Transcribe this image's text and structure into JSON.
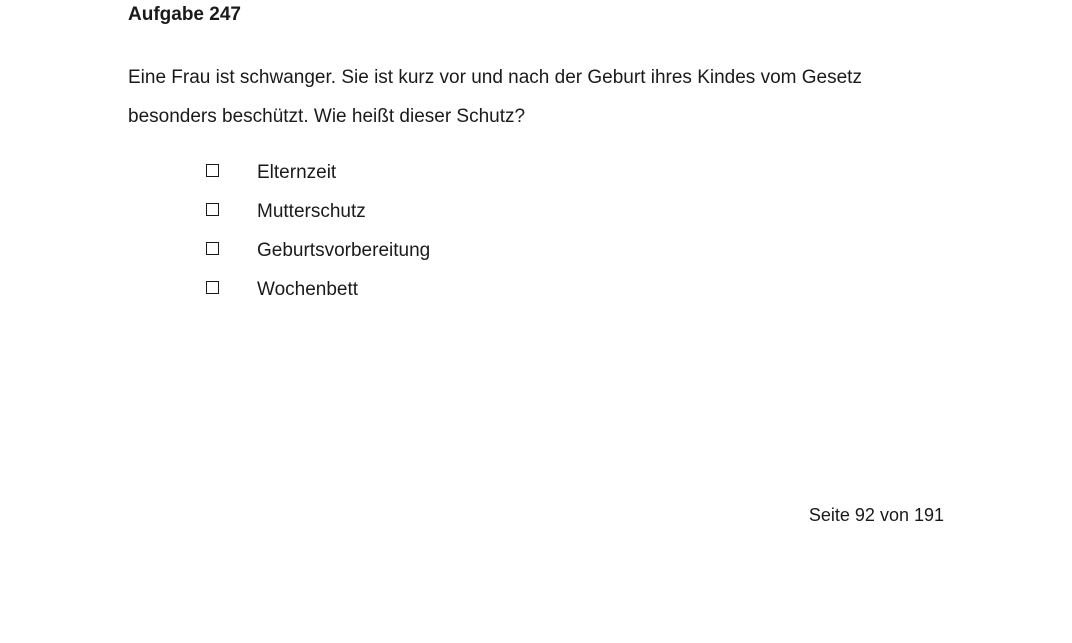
{
  "task": {
    "title": "Aufgabe 247",
    "question_line1": "Eine Frau ist schwanger. Sie ist kurz vor und nach der Geburt ihres Kindes vom Gesetz",
    "question_line2": "besonders beschützt. Wie heißt dieser Schutz?"
  },
  "answers": [
    {
      "label": "Elternzeit",
      "checked": false
    },
    {
      "label": "Mutterschutz",
      "checked": false
    },
    {
      "label": "Geburtsvorbereitung",
      "checked": false
    },
    {
      "label": "Wochenbett",
      "checked": false
    }
  ],
  "footer": {
    "page_number": "Seite 92 von 191"
  }
}
